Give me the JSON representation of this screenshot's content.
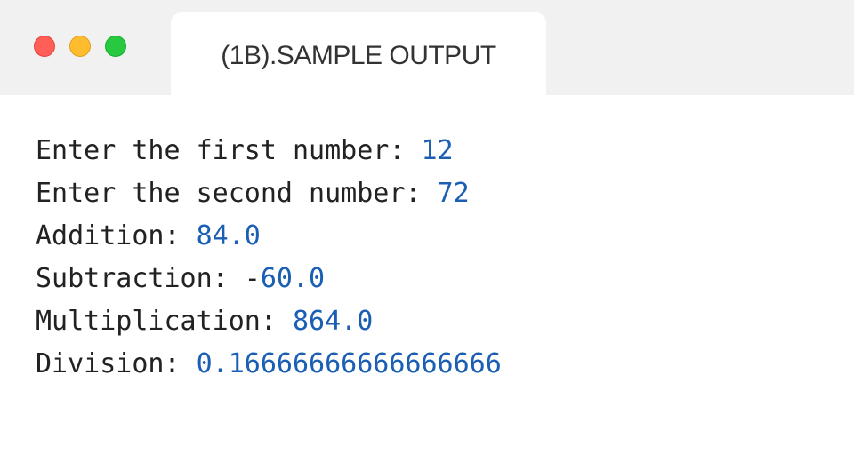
{
  "window": {
    "tab_title": "(1B).SAMPLE OUTPUT",
    "controls": [
      "close",
      "minimize",
      "maximize"
    ]
  },
  "colors": {
    "prompt_text": "#222222",
    "value_text": "#1a5fb4",
    "titlebar_bg": "#f1f1f1"
  },
  "console": {
    "lines": [
      {
        "prompt": "Enter the first number: ",
        "value": "12"
      },
      {
        "prompt": "Enter the second number: ",
        "value": "72"
      },
      {
        "prompt": "Addition: ",
        "value": "84.0"
      },
      {
        "prompt": "Subtraction: -",
        "value": "60.0"
      },
      {
        "prompt": "Multiplication: ",
        "value": "864.0"
      },
      {
        "prompt": "Division: ",
        "value": "0.16666666666666666"
      }
    ]
  }
}
